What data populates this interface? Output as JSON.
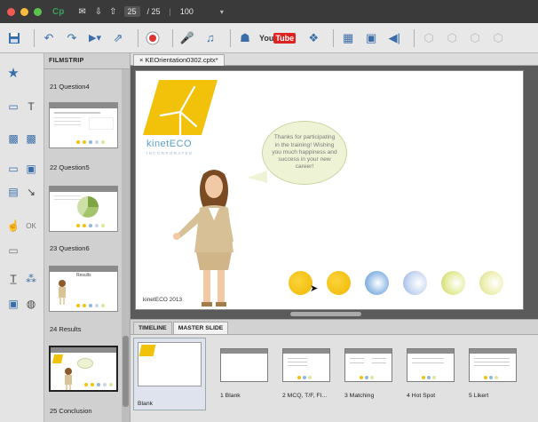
{
  "titlebar": {
    "page_current": "25",
    "page_total": "/ 25",
    "zoom": "100"
  },
  "toolbar": {
    "youtube_label": "YouTube"
  },
  "filmstrip": {
    "tab_label": "FILMSTRIP",
    "slides": [
      {
        "label": "21 Question4"
      },
      {
        "label": "22 Question5"
      },
      {
        "label": "23 Question6"
      },
      {
        "label": "24 Results"
      },
      {
        "label": "25 Conclusion"
      }
    ],
    "thumb_titles": {
      "results": "Results"
    }
  },
  "document": {
    "tab_label": "× KEOrientation0302.cptx*"
  },
  "slide": {
    "brand_name": "kinetECO",
    "brand_sub": "INCORPORATED",
    "speech": "Thanks for participating in the training! Wishing you much happiness and success in your new career!",
    "footer": "kinetECO 2013"
  },
  "bottom_panel": {
    "tabs": [
      {
        "label": "TIMELINE"
      },
      {
        "label": "MASTER SLIDE"
      }
    ],
    "master_slides": [
      {
        "label": "Blank"
      },
      {
        "label": "1 Blank"
      },
      {
        "label": "2 MCQ, T/F, FI..."
      },
      {
        "label": "3 Matching"
      },
      {
        "label": "4 Hot Spot"
      },
      {
        "label": "5 Likert"
      }
    ]
  },
  "colors": {
    "accent_yellow": "#f2c20a",
    "brand_blue": "#5aa0c8",
    "speech_bg": "#eef3d6"
  }
}
